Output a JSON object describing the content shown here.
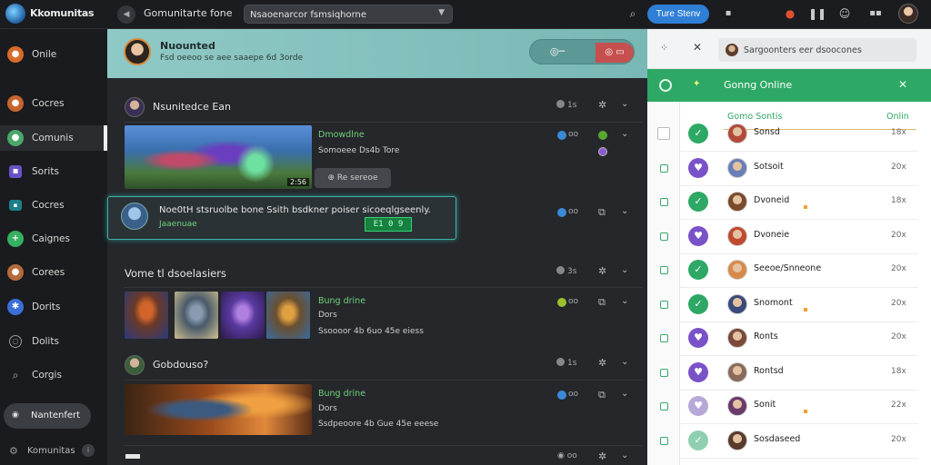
{
  "topbar": {
    "brand": "Kkomunitas",
    "app_title": "Gomunitarte fone",
    "search_value": "Nsaoenarcor fsmsiqhorne",
    "join_label": "Ture Stenv"
  },
  "sidebar": {
    "items": [
      {
        "label": "Onile",
        "icon": "user-icon",
        "color": "#d86b2a"
      },
      {
        "label": "Cocres",
        "icon": "user-icon",
        "color": "#c5652f"
      },
      {
        "label": "Comunis",
        "icon": "user-icon",
        "color": "#4aa868"
      },
      {
        "label": "Sorits",
        "icon": "grid-icon",
        "color": "#6a52c8"
      },
      {
        "label": "Cocres",
        "icon": "chat-icon",
        "color": "#1c7f8a"
      },
      {
        "label": "Caignes",
        "icon": "plus-icon",
        "color": "#35b060"
      },
      {
        "label": "Corees",
        "icon": "user-icon",
        "color": "#b56a3a"
      },
      {
        "label": "Dorits",
        "icon": "gear-icon",
        "color": "#3a6fd8"
      },
      {
        "label": "Dolits",
        "icon": "circle-icon",
        "color": "#3a3d42"
      },
      {
        "label": "Corgis",
        "icon": "search-icon",
        "color": "#3a3d42"
      }
    ],
    "network_label": "Nantenfert",
    "footer_label": "Komunitas"
  },
  "banner": {
    "title": "Nuounted",
    "subtitle": "Fsd oeeoo se aee saaepe 6d 3orde"
  },
  "feed": {
    "header1": {
      "name": "Nsunitedce Ean",
      "meta": "1s"
    },
    "post1": {
      "line1": "Dmowdlne",
      "line2": "Somoeee Ds4b Tore",
      "tag": "2:56",
      "follow_label": "Re sereoe"
    },
    "notice": {
      "text": "Noe0tH stsruolbe bone Ssith bsdkner poiser sicoeqlgseenly.",
      "subtext": "Jaaenuae",
      "badge": "E1 0 9"
    },
    "header2": {
      "name": "Vome tl dsoelasiers",
      "meta": "3s"
    },
    "post2": {
      "line1": "Bung drine",
      "line2": "Dors",
      "line3": "Ssoooor 4b 6uo 45e eiess"
    },
    "header3": {
      "name": "Gobdouso?",
      "meta": "1s"
    },
    "post3": {
      "line1": "Bung drine",
      "line2": "Dors",
      "line3": "Ssdpeoore 4b Gue 45e eeese"
    }
  },
  "right_panel": {
    "search_value": "Sargoonters eer dsoocones",
    "title": "Gonng Online",
    "subhead_left": "Gomo Sontis",
    "subhead_right": "Onlin",
    "people": [
      {
        "name": "Sonsd",
        "count": "18x",
        "status": "check",
        "avatar": "#b24a3a",
        "checked": true
      },
      {
        "name": "Sotsoit",
        "count": "20x",
        "status": "heart",
        "avatar": "#6a7fb8",
        "checked": false
      },
      {
        "name": "Dvoneid",
        "count": "18x",
        "status": "check",
        "avatar": "#7a4a2a",
        "checked": false
      },
      {
        "name": "Dvoneie",
        "count": "20x",
        "status": "heart",
        "avatar": "#c04a30",
        "checked": false
      },
      {
        "name": "Seeoe/Snneone",
        "count": "20x",
        "status": "check",
        "avatar": "#d88a4a",
        "checked": false
      },
      {
        "name": "Snomont",
        "count": "20x",
        "status": "check",
        "avatar": "#3a4a7a",
        "checked": false
      },
      {
        "name": "Ronts",
        "count": "20x",
        "status": "heart",
        "avatar": "#7a4a3a",
        "checked": false
      },
      {
        "name": "Rontsd",
        "count": "18x",
        "status": "heart",
        "avatar": "#8a6a5a",
        "checked": false
      },
      {
        "name": "Sonit",
        "count": "22x",
        "status": "heart-light",
        "avatar": "#6a3a6a",
        "checked": false
      },
      {
        "name": "Sosdaseed",
        "count": "20x",
        "status": "check-light",
        "avatar": "#5a3a2a",
        "checked": false
      }
    ]
  }
}
